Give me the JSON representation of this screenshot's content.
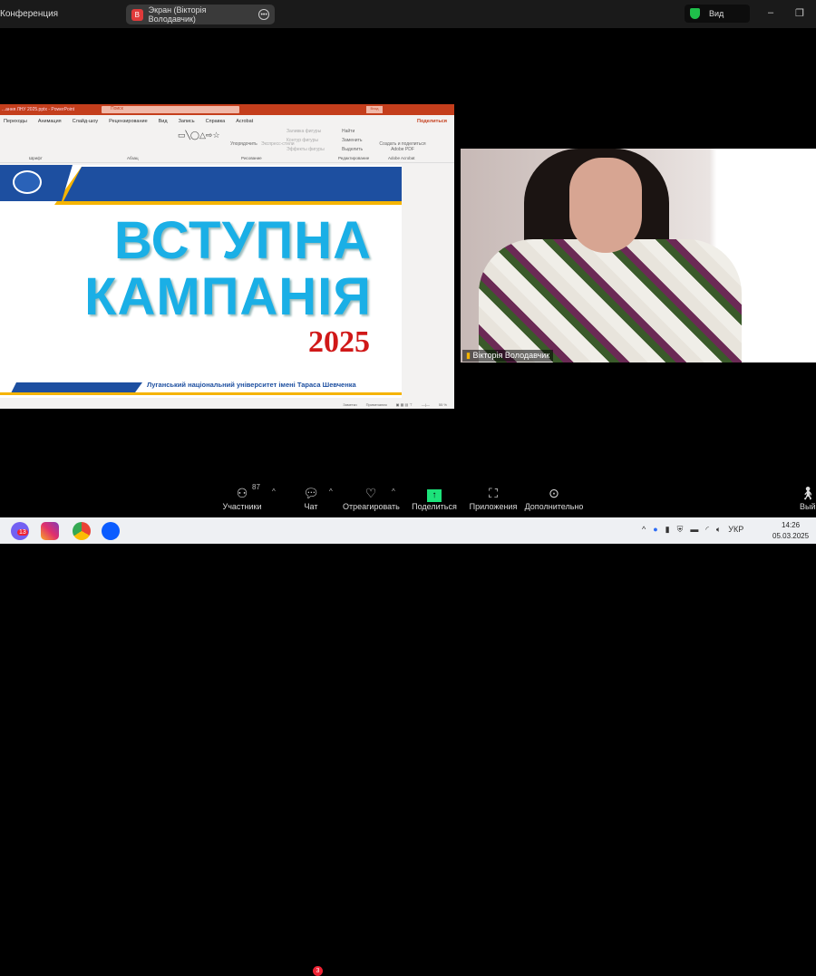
{
  "topbar": {
    "title": "Конференция",
    "share_badge": "В",
    "share_label": "Экран (Вікторія Володавчик)",
    "view_label": "Вид"
  },
  "ppt": {
    "filename": "...ання ЛНУ 2025.pptx - PowerPoint",
    "search": "Поиск",
    "signin": "Вход",
    "tabs": [
      "Переходы",
      "Анимация",
      "Слайд-шоу",
      "Рецензирование",
      "Вид",
      "Запись",
      "Справка",
      "Acrobat"
    ],
    "share": "Поделиться",
    "groups": [
      "Шрифт",
      "Абзац",
      "Рисование",
      "Редактирование",
      "Adobe Acrobat"
    ],
    "ribbon": {
      "arrange": "Упорядочить",
      "express": "Экспресс-стили",
      "fill": "Заливка фигуры",
      "outline": "Контур фигуры",
      "effects": "Эффекты фигуры",
      "find": "Найти",
      "replace": "Заменить",
      "select": "Выделить",
      "acrobat": "Создать и поделиться Adobe PDF"
    },
    "slide": {
      "line1": "ВСТУПНА",
      "line2": "КАМПАНІЯ",
      "year": "2025",
      "footer": "Луганський національний університет імені Тараса Шевченка"
    },
    "status": {
      "notes": "Заметки",
      "comments": "Примечания",
      "zoom": "55 %"
    }
  },
  "video": {
    "name": "Вікторія Володавчик"
  },
  "controls": {
    "participants": "Участники",
    "participants_count": "87",
    "chat": "Чат",
    "chat_badge": "3",
    "react": "Отреагировать",
    "share": "Поделиться",
    "apps": "Приложения",
    "more": "Дополнительно",
    "leave": "Вый"
  },
  "taskbar": {
    "viber_badge": "13",
    "lang": "УКР",
    "time": "14:26",
    "date": "05.03.2025"
  }
}
